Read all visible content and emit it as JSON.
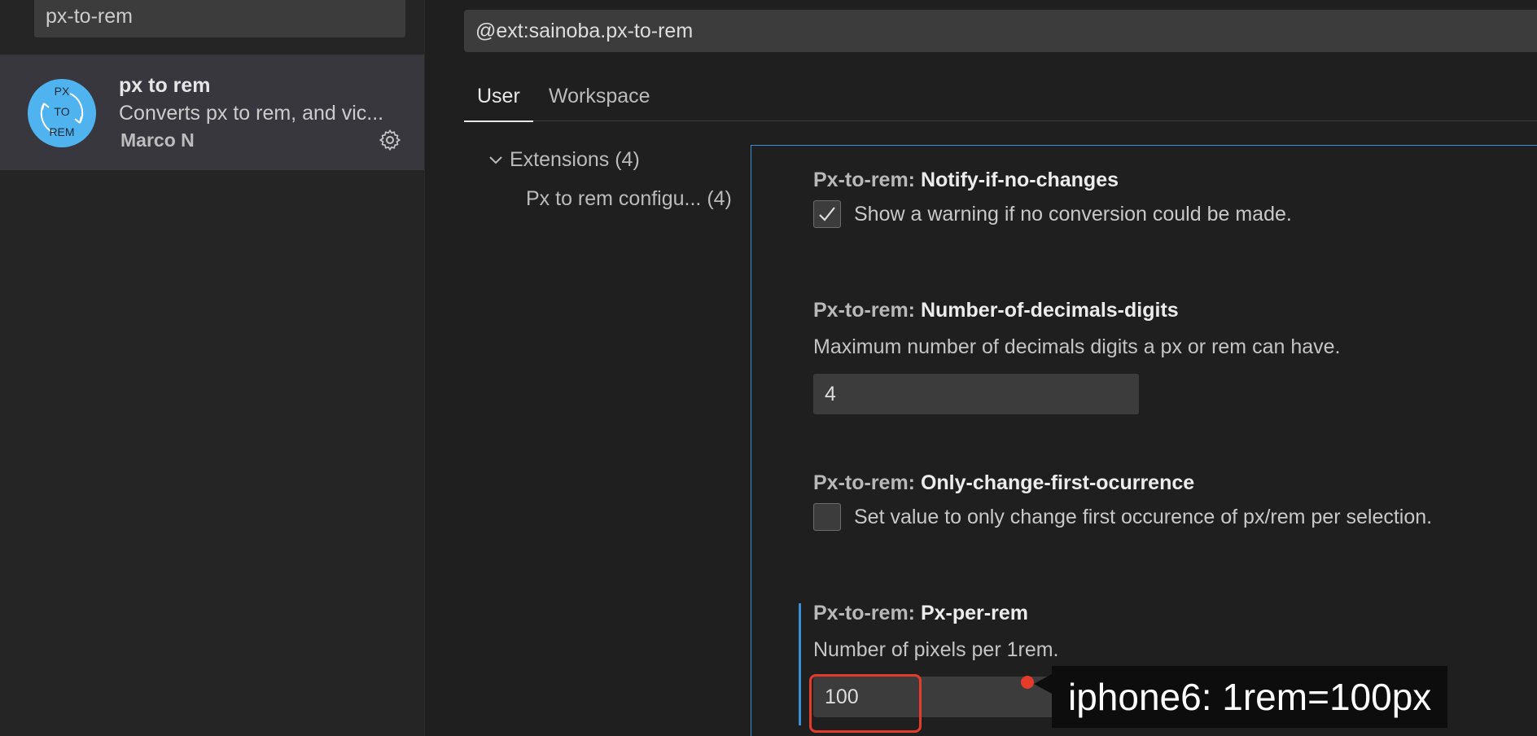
{
  "sidebar": {
    "search_value": "px-to-rem",
    "extension": {
      "logo_text": [
        "PX",
        "TO",
        "REM"
      ],
      "name": "px to rem",
      "description": "Converts px to rem, and vic...",
      "author": "Marco N",
      "settings_icon": "gear-icon"
    }
  },
  "main": {
    "search_value": "@ext:sainoba.px-to-rem",
    "tabs": [
      {
        "label": "User"
      },
      {
        "label": "Workspace"
      }
    ],
    "tree": {
      "root_label": "Extensions (4)",
      "child_label": "Px to rem configu... (4)"
    },
    "settings": [
      {
        "category": "Px-to-rem: ",
        "key": "Notify-if-no-changes",
        "checkbox_label": "Show a warning if no conversion could be made.",
        "checked": true
      },
      {
        "category": "Px-to-rem: ",
        "key": "Number-of-decimals-digits",
        "description": "Maximum number of decimals digits a px or rem can have.",
        "value": "4"
      },
      {
        "category": "Px-to-rem: ",
        "key": "Only-change-first-ocurrence",
        "checkbox_label": "Set value to only change first occurence of px/rem per selection.",
        "checked": false
      },
      {
        "category": "Px-to-rem: ",
        "key": "Px-per-rem",
        "description": "Number of pixels per 1rem.",
        "value": "100"
      }
    ]
  },
  "annotation": {
    "callout_text": "iphone6: 1rem=100px",
    "highlight_color": "#e53b2b"
  }
}
